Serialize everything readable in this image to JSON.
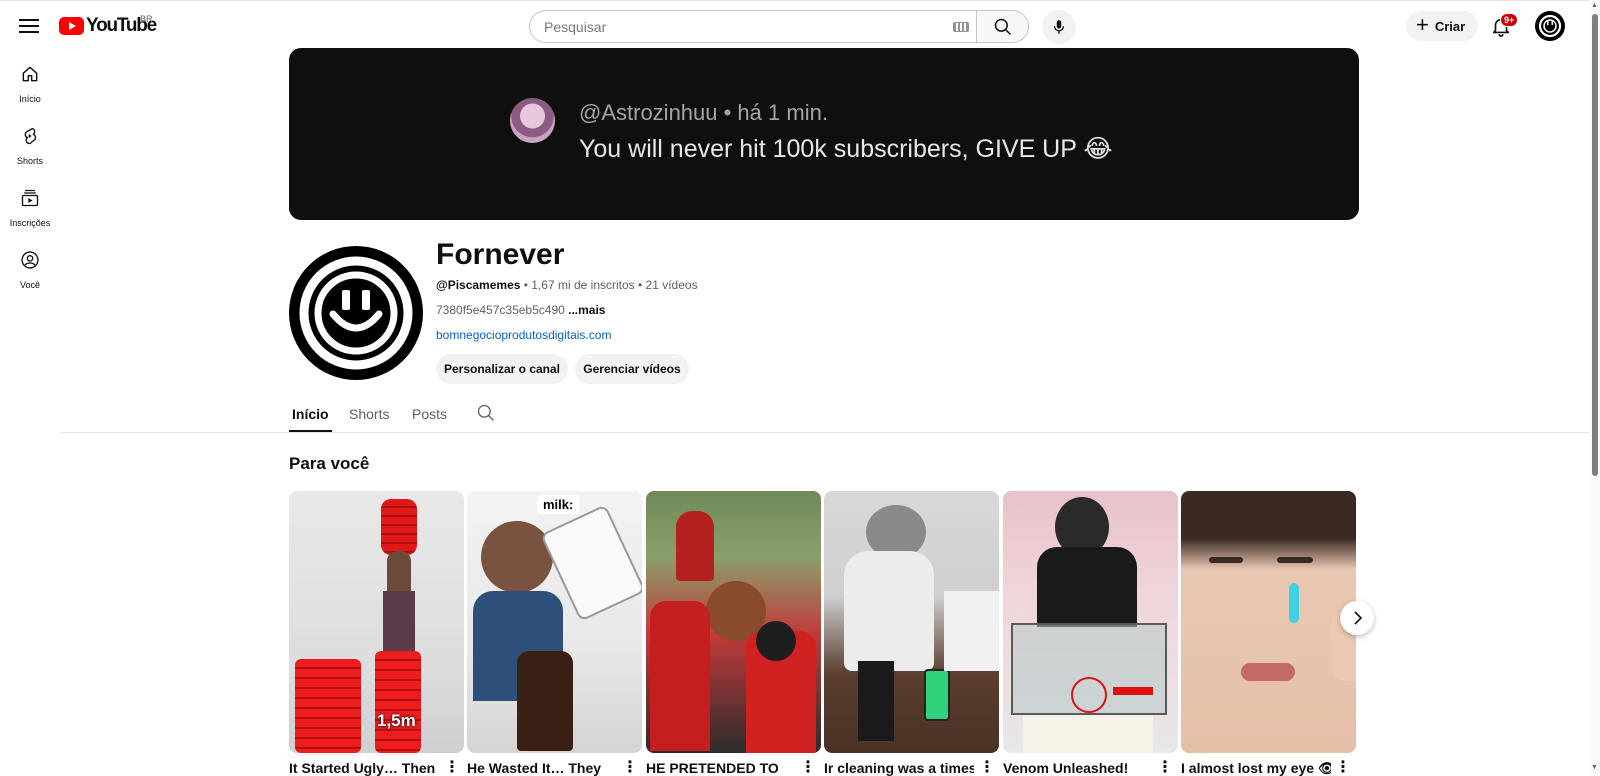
{
  "header": {
    "logo_text": "YouTube",
    "country": "BR",
    "search_placeholder": "Pesquisar",
    "create_label": "Criar",
    "notifications_badge": "9+"
  },
  "sidebar": {
    "items": [
      {
        "label": "Início",
        "icon": "home-icon"
      },
      {
        "label": "Shorts",
        "icon": "shorts-icon"
      },
      {
        "label": "Inscrições",
        "icon": "subscriptions-icon"
      },
      {
        "label": "Você",
        "icon": "you-icon"
      }
    ]
  },
  "banner": {
    "meta": "@Astrozinhuu • há 1 min.",
    "text": "You will never hit 100k subscribers, GIVE UP 😂"
  },
  "channel": {
    "name": "Fornever",
    "handle": "@Piscamemes",
    "stats": " • 1,67 mi de inscritos • 21 vídeos",
    "description": "7380f5e457c35eb5c490 ",
    "more_label": "...mais",
    "link": "bomnegocioprodutosdigitais.com",
    "customize_label": "Personalizar o canal",
    "manage_label": "Gerenciar vídeos"
  },
  "tabs": [
    "Início",
    "Shorts",
    "Posts"
  ],
  "section": {
    "title": "Para você"
  },
  "shorts": [
    {
      "title": "It Started Ugly… Then",
      "overlay": "1,5m"
    },
    {
      "title": "He Wasted It… They",
      "overlay": "milk:"
    },
    {
      "title": "HE PRETENDED TO",
      "overlay": ""
    },
    {
      "title": "Ir cleaning was a times",
      "overlay": ""
    },
    {
      "title": "Venom Unleashed!",
      "overlay": ""
    },
    {
      "title": "I almost lost my eye 👁",
      "overlay": ""
    }
  ],
  "colors": {
    "brand_red": "#ff0000",
    "link_blue": "#065fd4",
    "banner_bg": "#0f0f0f"
  }
}
